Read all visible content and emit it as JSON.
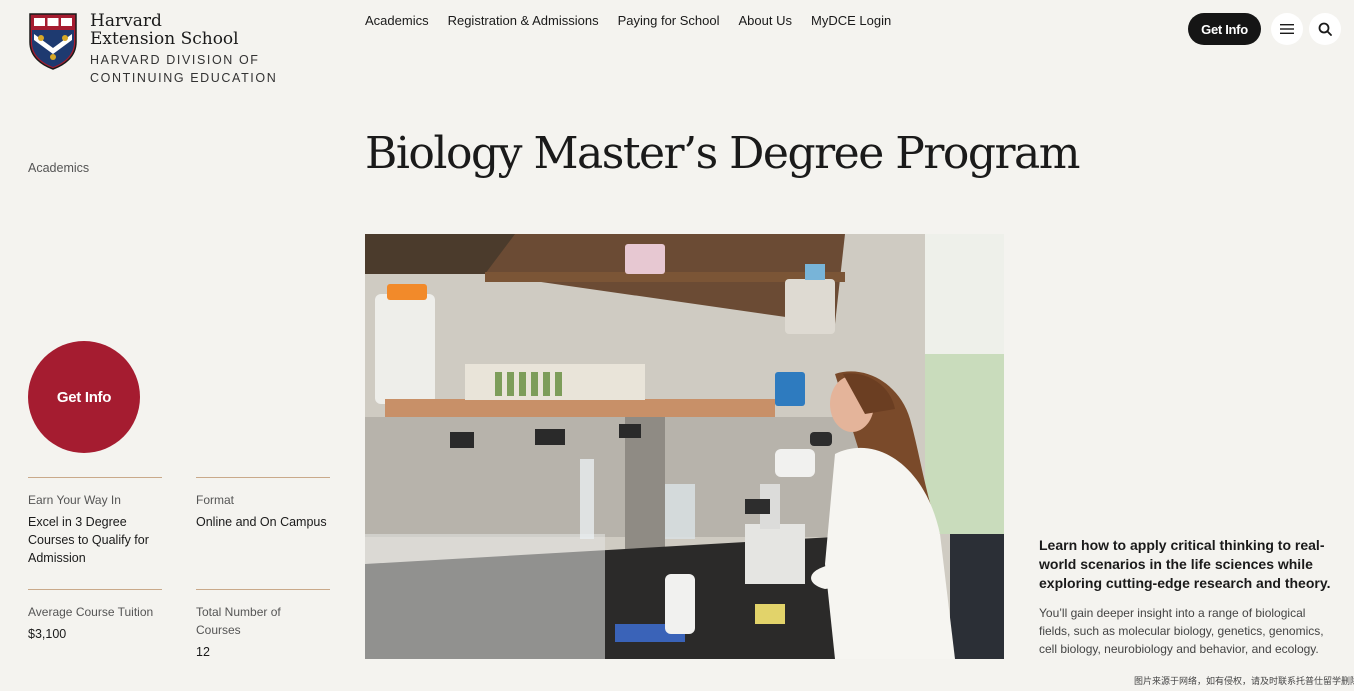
{
  "header": {
    "logo_line1": "Harvard",
    "logo_line2": "Extension School",
    "logo_sub1": "HARVARD DIVISION OF",
    "logo_sub2": "CONTINUING EDUCATION",
    "nav": [
      "Academics",
      "Registration & Admissions",
      "Paying for School",
      "About Us",
      "MyDCE Login"
    ],
    "get_info_label": "Get Info",
    "icons": {
      "menu": "hamburger-menu-icon",
      "search": "search-icon"
    }
  },
  "sidebar": {
    "breadcrumb": "Academics",
    "cta_label": "Get Info",
    "facts": [
      {
        "label": "Earn Your Way In",
        "value": "Excel in 3 Degree Courses to Qualify for Admission"
      },
      {
        "label": "Format",
        "value": "Online and On Campus"
      },
      {
        "label": "Average Course Tuition",
        "value": "$3,100"
      },
      {
        "label": "Total Number of Courses",
        "value": "12"
      }
    ]
  },
  "main": {
    "title": "Biology Master’s Degree Program",
    "lead": "Learn how to apply critical thinking to real-world scenarios in the life sciences while exploring cutting-edge research and theory.",
    "description": "You’ll gain deeper insight into a range of biological fields, such as molecular biology, genetics, genomics, cell biology, neurobiology and behavior, and ecology.",
    "footnote": "图片来源于网络，如有侵权，请及时联系托普仕留学删除"
  },
  "colors": {
    "crimson": "#a51c30",
    "background": "#f4f3ef",
    "dark": "#151515"
  }
}
